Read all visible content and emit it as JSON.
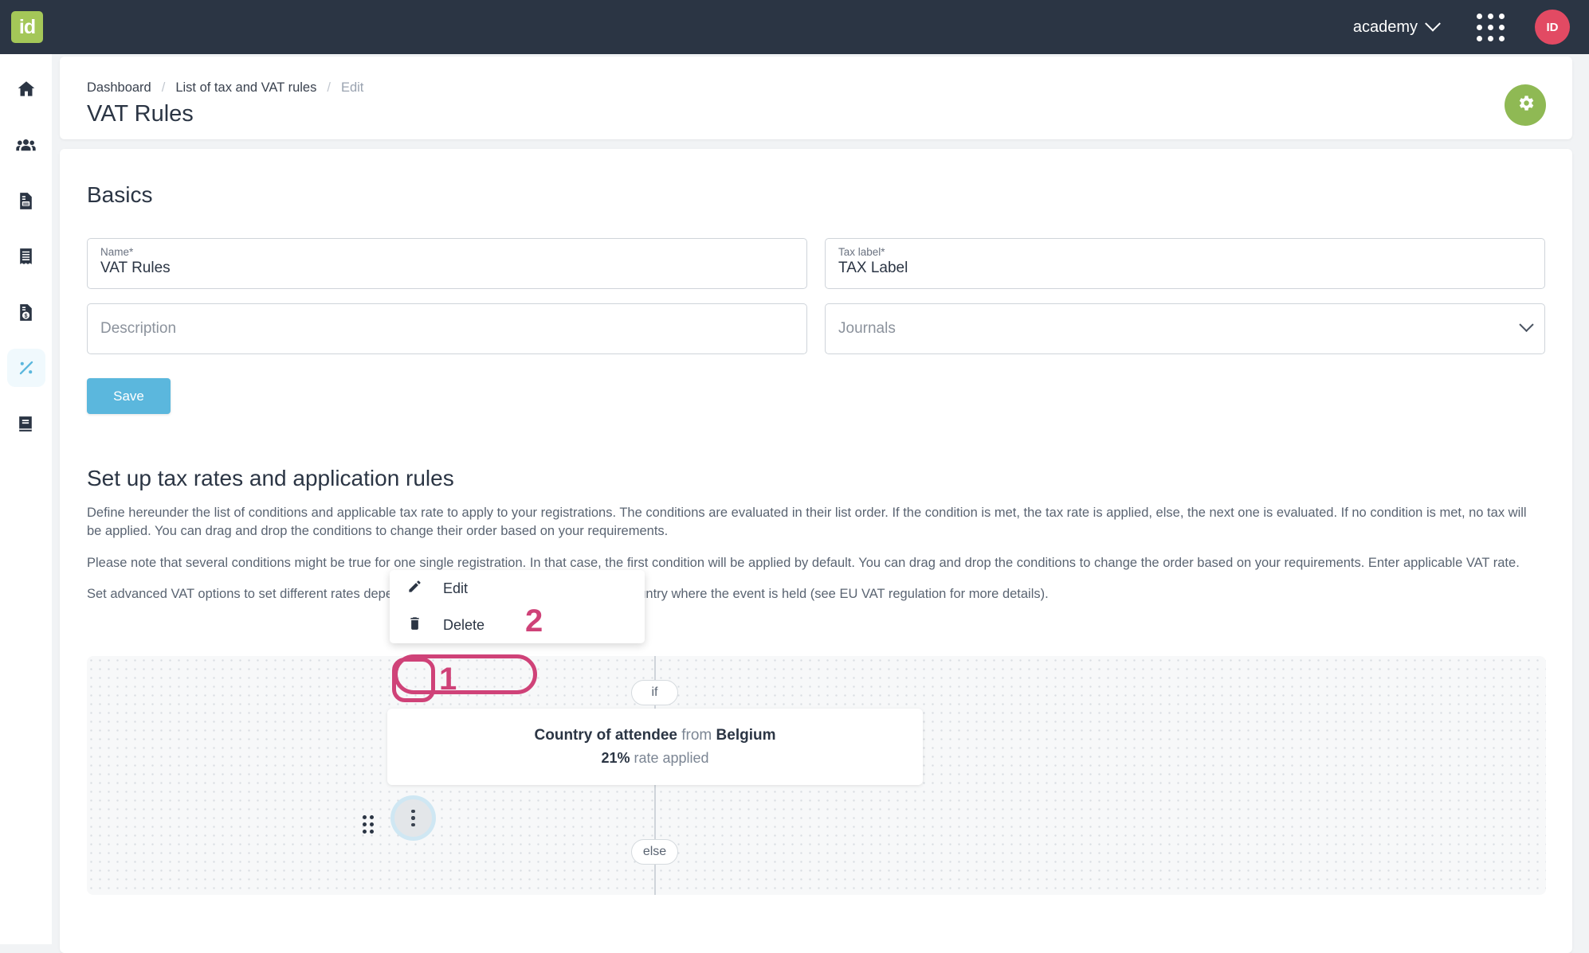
{
  "topbar": {
    "logo_text": "id",
    "org_name": "academy",
    "avatar_initials": "ID"
  },
  "sidebar": {
    "items": [
      {
        "name": "home",
        "icon": "home-icon",
        "active": false
      },
      {
        "name": "people",
        "icon": "people-icon",
        "active": false
      },
      {
        "name": "documents",
        "icon": "document-icon",
        "active": false
      },
      {
        "name": "receipts",
        "icon": "receipt-icon",
        "active": false
      },
      {
        "name": "invoices",
        "icon": "invoice-dollar-icon",
        "active": false
      },
      {
        "name": "taxes",
        "icon": "percent-icon",
        "active": true
      },
      {
        "name": "library",
        "icon": "book-icon",
        "active": false
      }
    ]
  },
  "header": {
    "breadcrumb": [
      {
        "label": "Dashboard",
        "muted": false
      },
      {
        "label": "List of tax and VAT rules",
        "muted": false
      },
      {
        "label": "Edit",
        "muted": true
      }
    ],
    "separator": "/",
    "title": "VAT Rules",
    "settings_icon": "gear-icon"
  },
  "basics": {
    "section_title": "Basics",
    "fields": {
      "name": {
        "label": "Name*",
        "value": "VAT Rules"
      },
      "tax_label": {
        "label": "Tax label*",
        "value": "TAX Label"
      },
      "description": {
        "placeholder": "Description",
        "value": ""
      },
      "journals": {
        "placeholder": "Journals",
        "value": ""
      }
    },
    "save_label": "Save"
  },
  "rules": {
    "title": "Set up tax rates and application rules",
    "paragraphs": [
      "Define hereunder the list of conditions and applicable tax rate to apply to your registrations. The conditions are evaluated in their list order. If the condition is met, the tax rate is applied, else, the next one is evaluated. If no condition is met, no tax will be applied. You can drag and drop the conditions to change their order based on your requirements.",
      "Please note that several conditions might be true for one single registration. In that case, the first condition will be applied by default. You can drag and drop the conditions to change the order based on your requirements. Enter applicable VAT rate.",
      "Set advanced VAT options to set different rates depending of the registrants country and the country where the event is held (see EU VAT regulation for more details)."
    ],
    "badges": {
      "if": "if",
      "else": "else"
    },
    "condition": {
      "subject": "Country of attendee",
      "connector": "from",
      "object": "Belgium",
      "rate": "21%",
      "rate_suffix": "rate applied"
    },
    "drag_handle_icon": "drag-handle-icon",
    "kebab_icon": "kebab-menu-icon"
  },
  "menu": {
    "items": [
      {
        "label": "Edit",
        "icon": "pencil-icon"
      },
      {
        "label": "Delete",
        "icon": "trash-icon"
      }
    ]
  },
  "annotations": {
    "step_one": "1",
    "step_two": "2",
    "color": "#cf4278"
  },
  "colors": {
    "topbar": "#2b3544",
    "logo_green": "#a4c758",
    "gear_green": "#8fb954",
    "accent_blue": "#5bb7dd",
    "avatar_red": "#e24a63",
    "annotation_pink": "#cf4278"
  }
}
